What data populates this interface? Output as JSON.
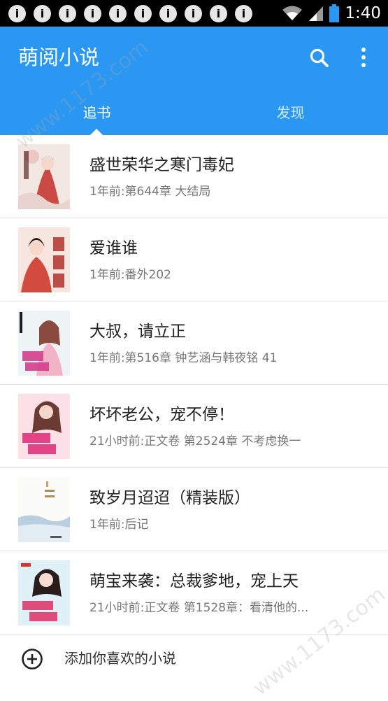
{
  "status_bar": {
    "notification_icons": [
      "i",
      "i",
      "i",
      "i",
      "i",
      "i",
      "i",
      "i",
      "i",
      "i"
    ],
    "time": "1:40"
  },
  "app_bar": {
    "title": "萌阅小说",
    "tabs": [
      {
        "label": "追书",
        "selected": true
      },
      {
        "label": "发现",
        "selected": false
      }
    ],
    "colors": {
      "bar": "#2a97f3",
      "tab_inactive": "#cfe6ff"
    }
  },
  "books": [
    {
      "title": "盛世荣华之寒门毒妃",
      "update": "1年前:第644章 大结局"
    },
    {
      "title": "爱谁谁",
      "update": "1年前:番外202"
    },
    {
      "title": "大叔，请立正",
      "update": "1年前:第516章 钟艺涵与韩夜铭 41"
    },
    {
      "title": "坏坏老公，宠不停！",
      "update": "21小时前:正文卷 第2524章 不考虑换一"
    },
    {
      "title": "致岁月迢迢（精装版）",
      "update": "1年前:后记"
    },
    {
      "title": "萌宝来袭：总裁爹地，宠上天",
      "update": "21小时前:正文卷 第1528章：看清他的..."
    }
  ],
  "add_row": {
    "label": "添加你喜欢的小说"
  },
  "watermark": {
    "text": "www.1173.com"
  }
}
